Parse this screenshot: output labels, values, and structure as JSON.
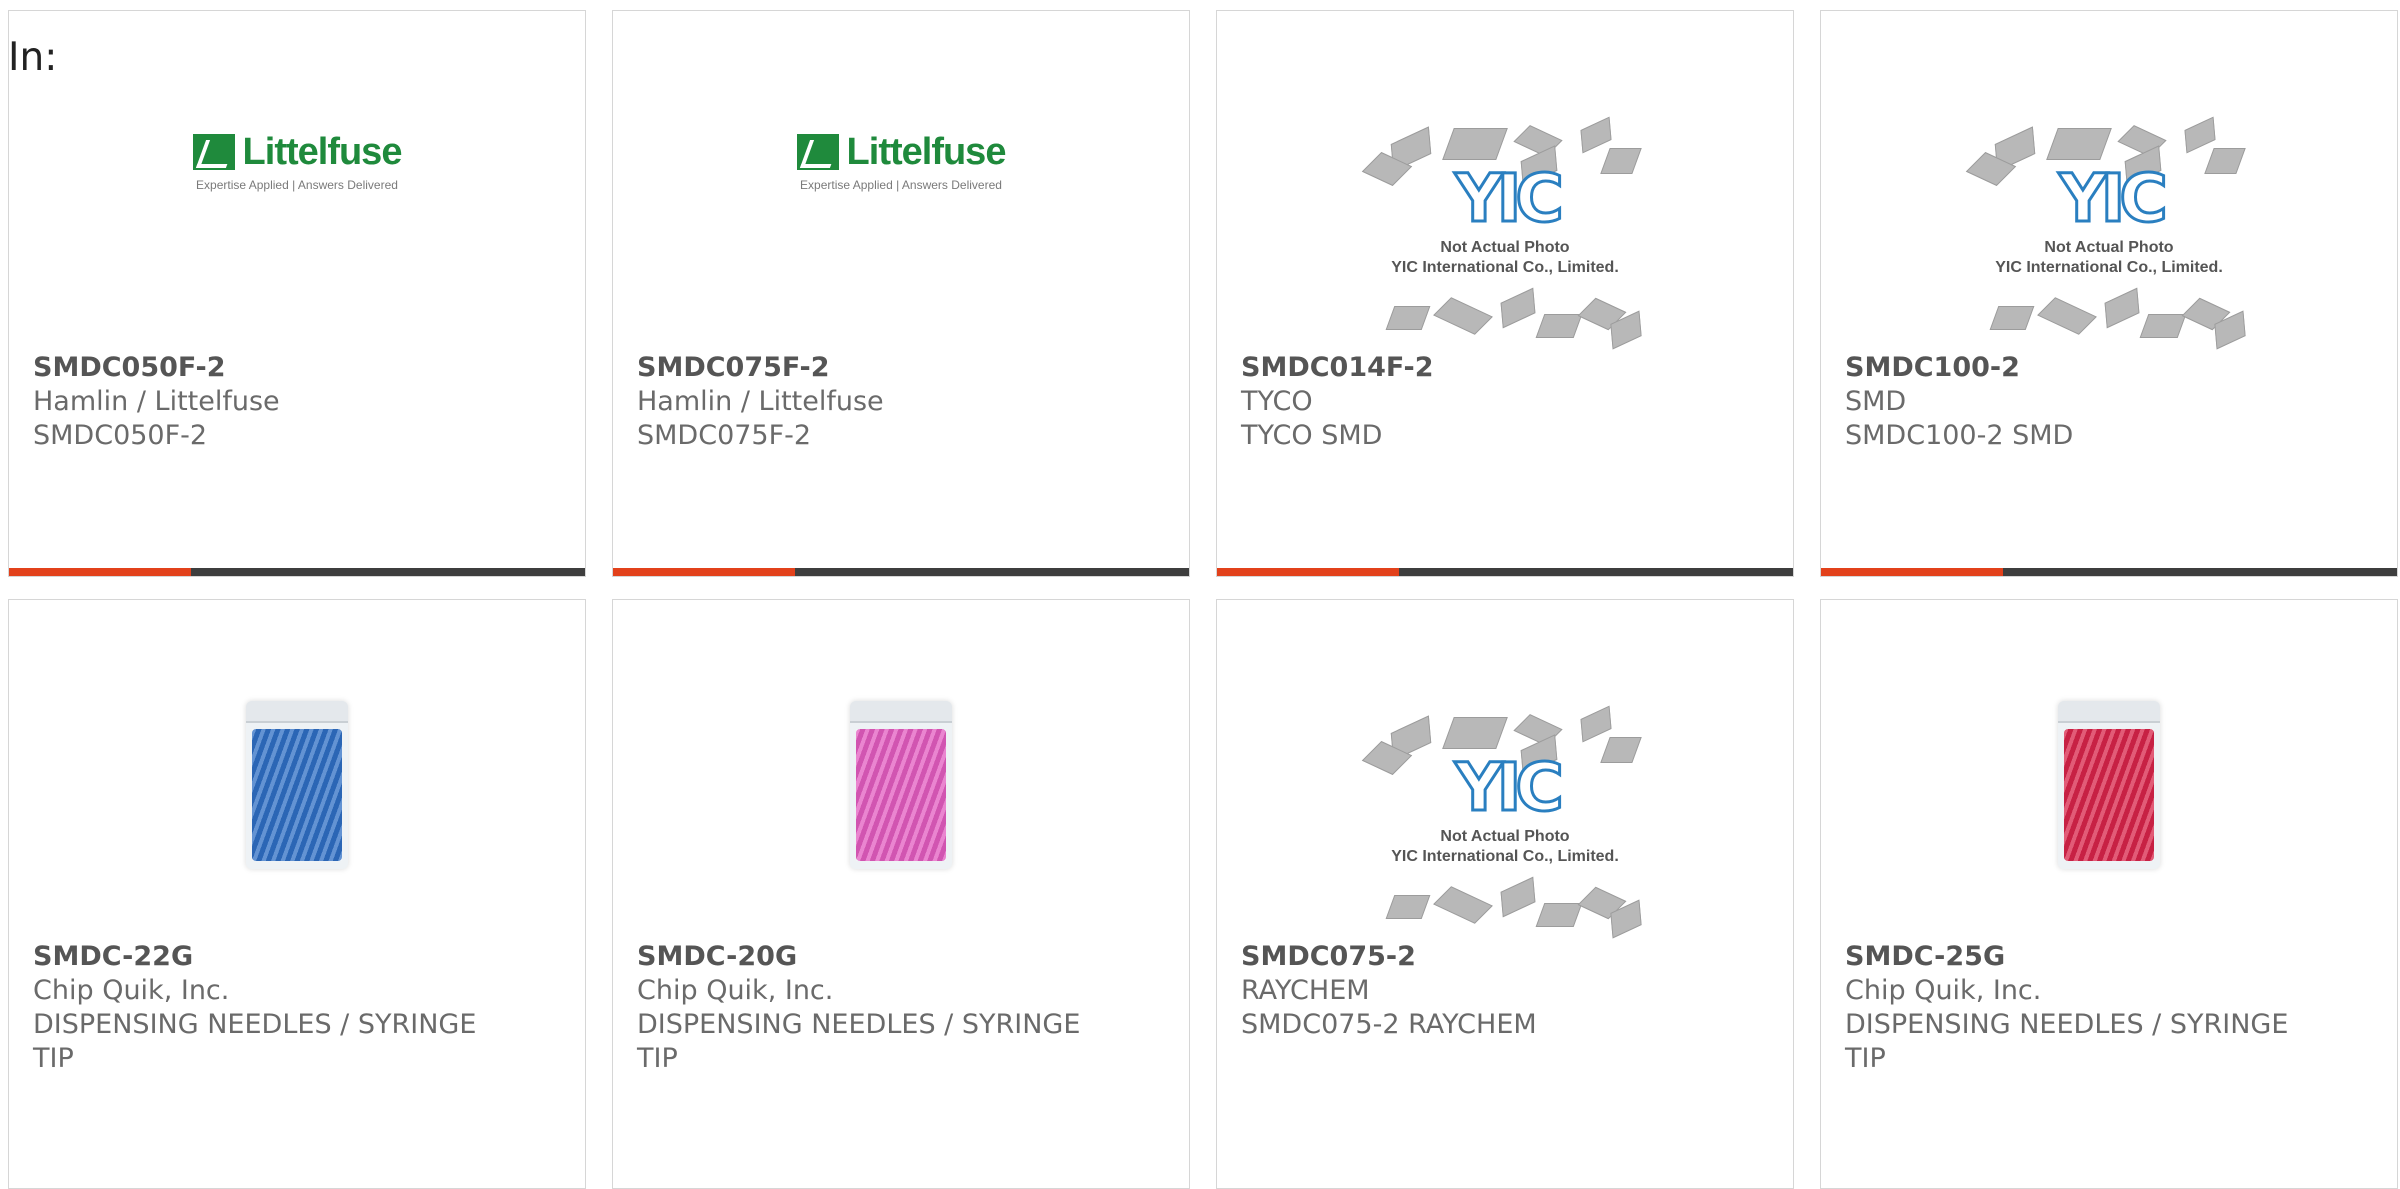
{
  "page": {
    "label": "In:"
  },
  "colors": {
    "accent": "#e2411b",
    "bar": "#3e3e3e",
    "littelfuse_green": "#1f8a3c",
    "yic_blue": "#2a7fc0"
  },
  "products": [
    {
      "part_no": "SMDC050F-2",
      "manufacturer": "Hamlin / Littelfuse",
      "description": "SMDC050F-2",
      "description2": "",
      "image": "littelfuse-logo",
      "logo_name": "Littelfuse",
      "logo_tagline": "Expertise Applied | Answers Delivered"
    },
    {
      "part_no": "SMDC075F-2",
      "manufacturer": "Hamlin / Littelfuse",
      "description": "SMDC075F-2",
      "description2": "",
      "image": "littelfuse-logo",
      "logo_name": "Littelfuse",
      "logo_tagline": "Expertise Applied | Answers Delivered"
    },
    {
      "part_no": "SMDC014F-2",
      "manufacturer": "TYCO",
      "description": "TYCO SMD",
      "description2": "",
      "image": "yic-placeholder",
      "placeholder_mark": "YIC",
      "placeholder_line1": "Not Actual Photo",
      "placeholder_line2": "YIC International Co., Limited."
    },
    {
      "part_no": "SMDC100-2",
      "manufacturer": "SMD",
      "description": "SMDC100-2 SMD",
      "description2": "",
      "image": "yic-placeholder",
      "placeholder_mark": "YIC",
      "placeholder_line1": "Not Actual Photo",
      "placeholder_line2": "YIC International Co., Limited."
    },
    {
      "part_no": "SMDC-22G",
      "manufacturer": "Chip Quik, Inc.",
      "description": "DISPENSING NEEDLES / SYRINGE",
      "description2": "TIP",
      "image": "tip-bag",
      "bag_color": "#2f6fc4"
    },
    {
      "part_no": "SMDC-20G",
      "manufacturer": "Chip Quik, Inc.",
      "description": "DISPENSING NEEDLES / SYRINGE",
      "description2": "TIP",
      "image": "tip-bag",
      "bag_color": "#e35cc0"
    },
    {
      "part_no": "SMDC075-2",
      "manufacturer": "RAYCHEM",
      "description": "SMDC075-2 RAYCHEM",
      "description2": "",
      "image": "yic-placeholder",
      "placeholder_mark": "YIC",
      "placeholder_line1": "Not Actual Photo",
      "placeholder_line2": "YIC International Co., Limited."
    },
    {
      "part_no": "SMDC-25G",
      "manufacturer": "Chip Quik, Inc.",
      "description": "DISPENSING NEEDLES / SYRINGE",
      "description2": "TIP",
      "image": "tip-bag",
      "bag_color": "#d8244a"
    }
  ]
}
